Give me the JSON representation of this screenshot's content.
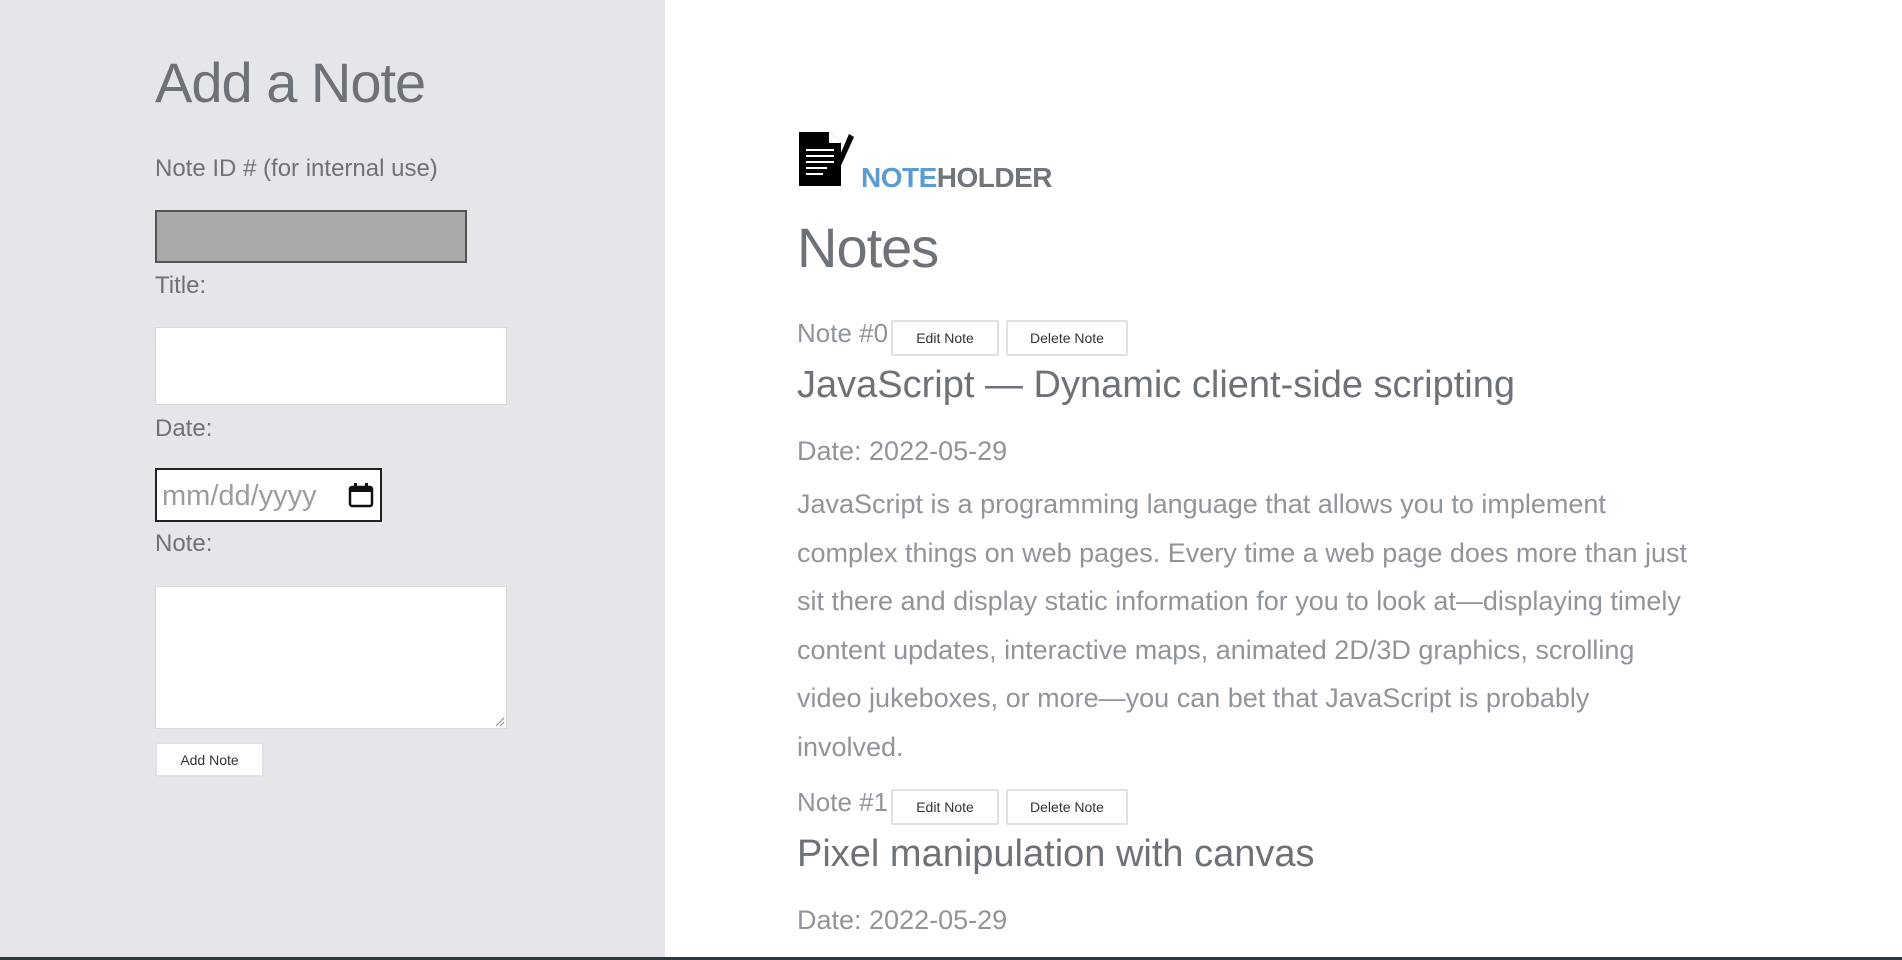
{
  "form": {
    "title": "Add a Note",
    "id_label": "Note ID # (for internal use)",
    "title_label": "Title:",
    "date_label": "Date:",
    "date_placeholder": "mm/dd/yyyy",
    "note_label": "Note:",
    "add_button": "Add Note"
  },
  "brand": {
    "note_part": "NOTE",
    "holder_part": "HOLDER",
    "note_color": "#5b9bd5",
    "holder_color": "#6f757b",
    "icon": "document-pen-icon"
  },
  "notes_heading": "Notes",
  "notes": [
    {
      "number": "Note #0",
      "edit_label": "Edit Note",
      "delete_label": "Delete Note",
      "title": "JavaScript — Dynamic client-side scripting",
      "date": "Date: 2022-05-29",
      "body": "JavaScript is a programming language that allows you to implement complex things on web pages. Every time a web page does more than just sit there and display static information for you to look at—displaying timely content updates, interactive maps, animated 2D/3D graphics, scrolling video jukeboxes, or more—you can bet that JavaScript is probably involved."
    },
    {
      "number": "Note #1",
      "edit_label": "Edit Note",
      "delete_label": "Delete Note",
      "title": "Pixel manipulation with canvas",
      "date": "Date: 2022-05-29"
    }
  ],
  "colors": {
    "sidebar_bg": "#e5e6ea",
    "heading_text": "#6d7278",
    "body_text": "#8f959b"
  }
}
